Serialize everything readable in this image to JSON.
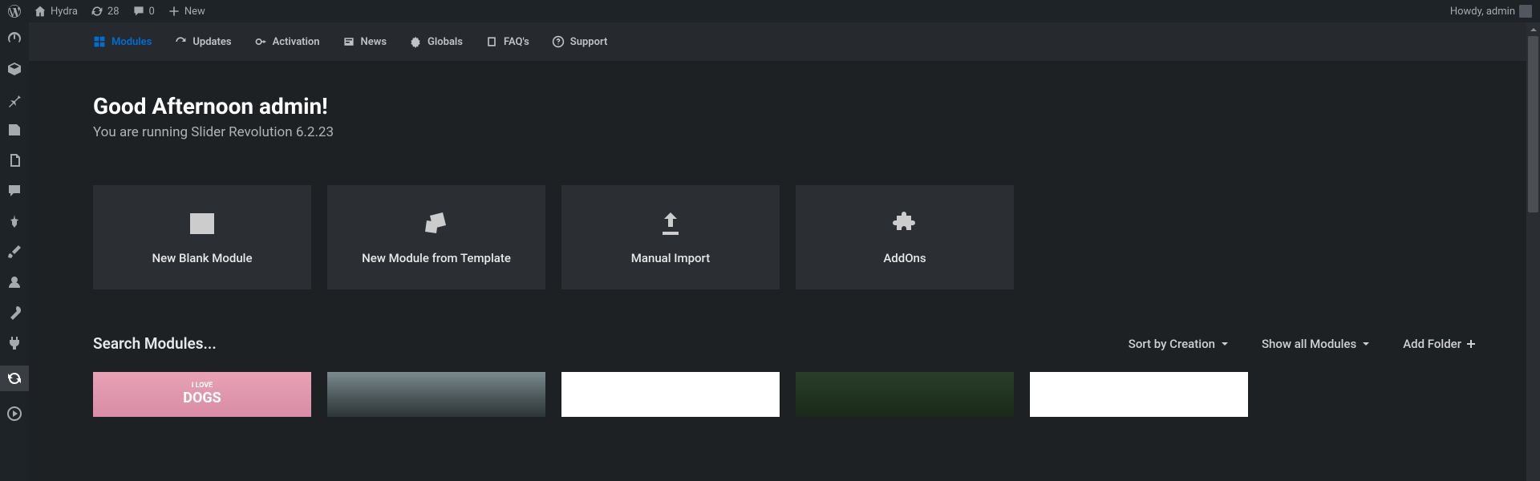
{
  "admin_bar": {
    "site_name": "Hydra",
    "updates_count": "28",
    "comments_count": "0",
    "new_label": "New",
    "howdy": "Howdy, admin"
  },
  "tabs": {
    "modules": "Modules",
    "updates": "Updates",
    "activation": "Activation",
    "news": "News",
    "globals": "Globals",
    "faqs": "FAQ's",
    "support": "Support"
  },
  "greeting": "Good Afternoon admin!",
  "subtitle": "You are running Slider Revolution 6.2.23",
  "cards": {
    "blank": "New Blank Module",
    "template": "New Module from Template",
    "import": "Manual Import",
    "addons": "AddOns"
  },
  "search_placeholder": "Search Modules...",
  "actions": {
    "sort": "Sort by Creation",
    "show": "Show all Modules",
    "add_folder": "Add Folder"
  },
  "thumb1_small": "I LOVE",
  "thumb1_big": "DOGS"
}
